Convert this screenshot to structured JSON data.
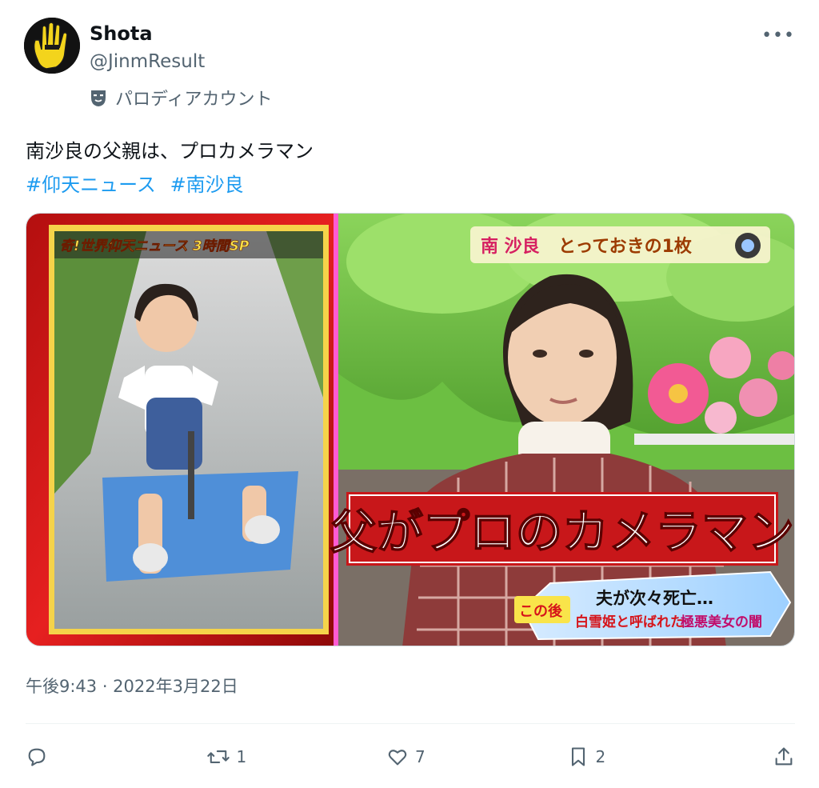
{
  "user": {
    "display_name": "Shota",
    "handle": "@JinmResult",
    "account_label": "パロディアカウント",
    "avatar": "avatar-hand-logo"
  },
  "tweet": {
    "text": "南沙良の父親は、プロカメラマン",
    "hashtags": [
      "#仰天ニュース",
      "#南沙良"
    ]
  },
  "media": {
    "left_panel_banner": "奇!世界仰天ニュース 3時間SP",
    "right_caption_name": "南 沙良",
    "right_caption_rest": "とっておきの1枚",
    "main_caption": "父がプロのカメラマン",
    "teaser_line1": "夫が次々死亡…",
    "teaser_prefix": "この後",
    "teaser_line2a": "白雪姫と呼ばれた",
    "teaser_line2b": "極悪美女の闇"
  },
  "timestamp": "午後9:43 · 2022年3月22日",
  "actions": {
    "reply_count": "",
    "retweet_count": "1",
    "like_count": "7",
    "bookmark_count": "2"
  },
  "colors": {
    "text": "#0f1419",
    "secondary": "#536471",
    "link": "#1d9bf0"
  }
}
